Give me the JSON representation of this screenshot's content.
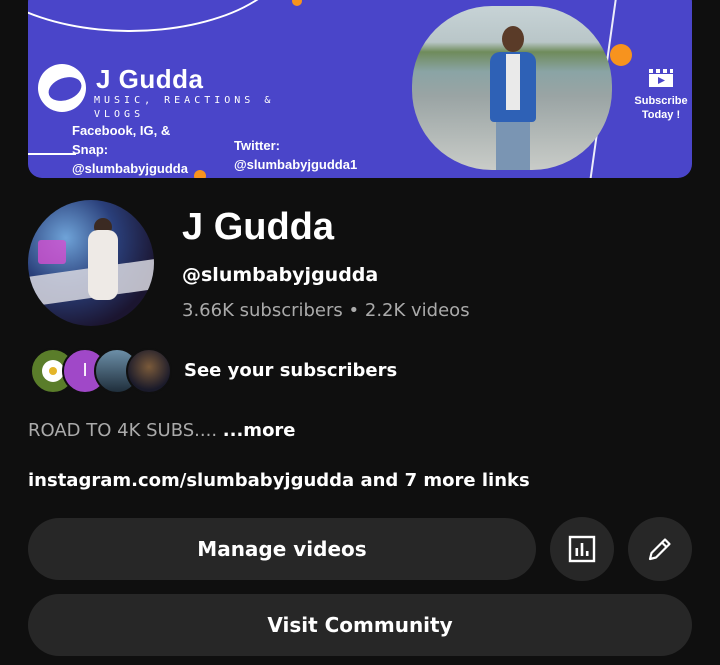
{
  "banner": {
    "brand_name": "J Gudda",
    "tagline": "MUSIC, REACTIONS & VLOGS",
    "social_line1": "Facebook, IG, &",
    "social_line2": "Snap:",
    "social_line3": "@slumbabyjgudda",
    "twitter_label": "Twitter:",
    "twitter_handle": "@slumbabyjgudda1",
    "subscribe_line1": "Subscribe",
    "subscribe_line2": "Today !",
    "accent_color": "#4a45c9",
    "highlight_color": "#f7931e"
  },
  "channel": {
    "name": "J Gudda",
    "handle": "@slumbabyjgudda",
    "subscribers": "3.66K subscribers",
    "separator": "•",
    "videos": "2.2K videos"
  },
  "subscribers_preview": {
    "avatar_2_initial": "I",
    "label": "See your subscribers"
  },
  "description": {
    "text": "ROAD TO 4K SUBS....",
    "more": "...more"
  },
  "links": {
    "text": "instagram.com/slumbabyjgudda and 7 more links"
  },
  "actions": {
    "manage_videos": "Manage videos",
    "analytics_icon": "bar-chart-icon",
    "edit_icon": "pencil-icon",
    "visit_community": "Visit Community"
  }
}
